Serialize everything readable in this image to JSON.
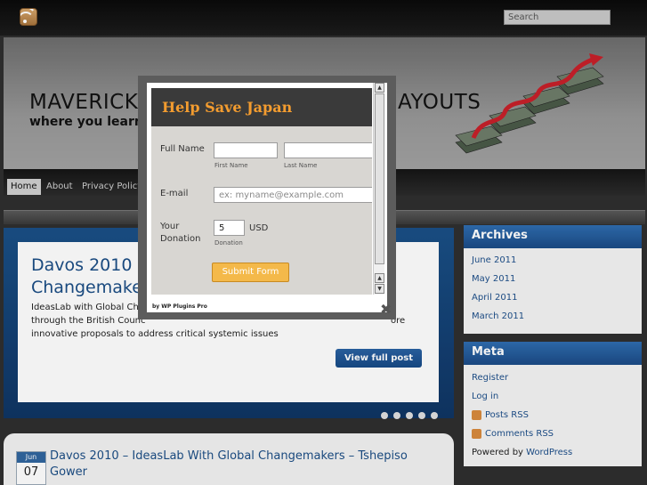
{
  "search": {
    "placeholder": "Search"
  },
  "header": {
    "title_start": "MAVERICK",
    "title_end": "AYOUTS",
    "tagline": "where you learn a"
  },
  "nav": {
    "items": [
      "Home",
      "About",
      "Privacy Policy"
    ]
  },
  "slider": {
    "title": "Davos 2010\nChangemake",
    "excerpt_line1": "IdeasLab with Global Chan",
    "excerpt_line2": "through the British Counc",
    "excerpt_line2_end": "ore",
    "excerpt_line3": "innovative proposals to address critical systemic issues",
    "button": "View full post",
    "dots": 5
  },
  "sidebar": {
    "archives_title": "Archives",
    "archives": [
      "June 2011",
      "May 2011",
      "April 2011",
      "March 2011"
    ],
    "meta_title": "Meta",
    "meta": [
      "Register",
      "Log in",
      "Posts RSS",
      "Comments RSS"
    ],
    "powered_prefix": "Powered by ",
    "powered_link": "WordPress"
  },
  "post": {
    "month": "Jun",
    "day": "07",
    "title": "Davos 2010 – IdeasLab With Global Changemakers – Tshepiso Gower"
  },
  "modal": {
    "title": "Help Save Japan",
    "full_name_label": "Full Name",
    "first_name_sub": "First Name",
    "last_name_sub": "Last Name",
    "email_label": "E-mail",
    "email_placeholder": "ex: myname@example.com",
    "donation_label": "Your\nDonation",
    "donation_value": "5",
    "currency": "USD",
    "donation_sub": "Donation",
    "submit": "Submit Form",
    "credit": "by WP Plugins Pro",
    "close": "✖"
  },
  "colors": {
    "accent": "#1b4d85",
    "orange": "#f39c2f"
  }
}
